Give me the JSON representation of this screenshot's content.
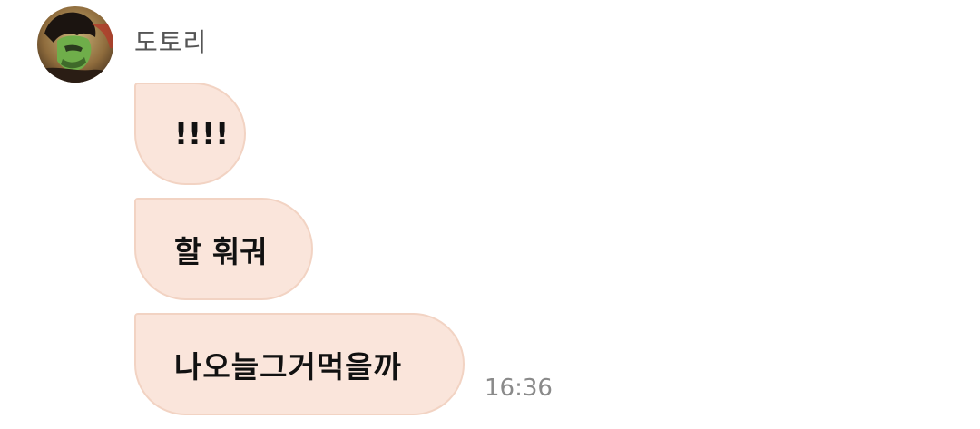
{
  "sender": {
    "name": "도토리",
    "avatar_icon": "profile-photo"
  },
  "messages": [
    {
      "text": "!!!!"
    },
    {
      "text": "할 훠궈"
    },
    {
      "text": "나오늘그거먹을까"
    }
  ],
  "timestamp": "16:36",
  "colors": {
    "bubble_fill": "#fae5db",
    "bubble_border": "#f2d3c3",
    "name_text": "#555555",
    "timestamp_text": "#8a8a8a"
  }
}
